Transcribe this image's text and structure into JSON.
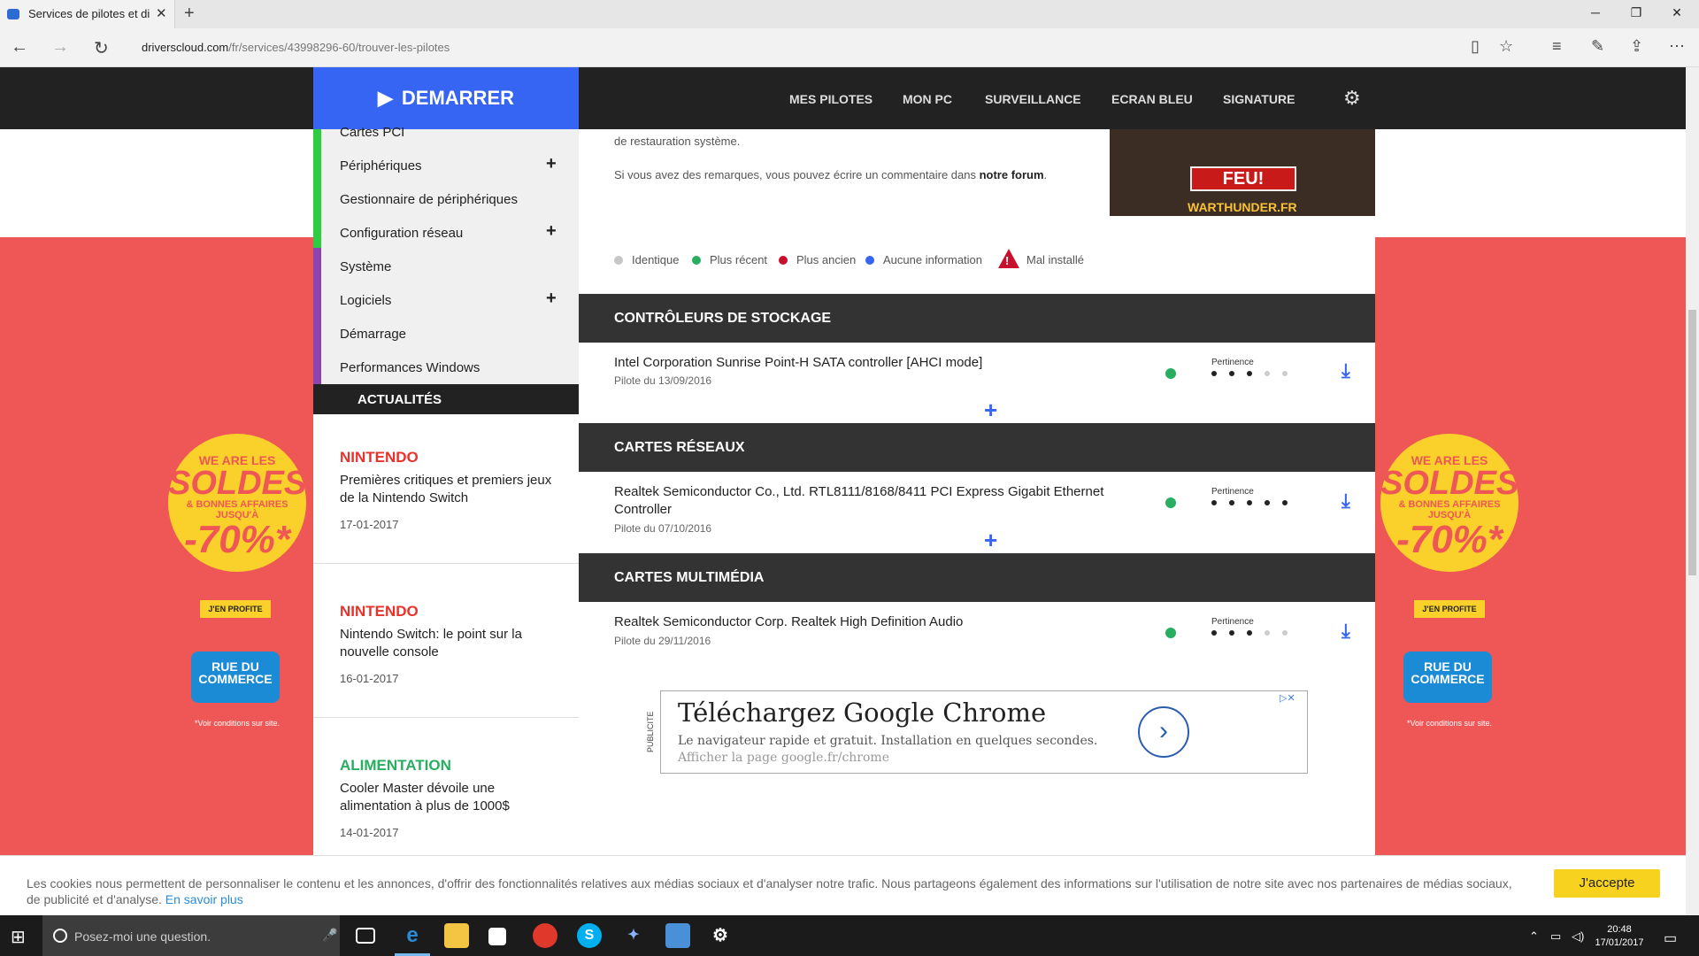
{
  "browser": {
    "tab_title": "Services de pilotes et di",
    "tab_close": "✕",
    "new_tab": "+",
    "url_domain": "driverscloud.com",
    "url_path": "/fr/services/43998296-60/trouver-les-pilotes"
  },
  "site_nav": {
    "demarrer": "DEMARRER",
    "links": [
      "MES PILOTES",
      "MON PC",
      "SURVEILLANCE",
      "ECRAN BLEU",
      "SIGNATURE"
    ]
  },
  "sidebar": {
    "items": [
      "Cartes PCI",
      "Périphériques",
      "Gestionnaire de périphériques",
      "Configuration réseau",
      "Système",
      "Logiciels",
      "Démarrage",
      "Performances Windows"
    ],
    "colors": [
      "#2ecc40",
      "#2ecc40",
      "#2ecc40",
      "#2ecc40",
      "#8e44ad",
      "#8e44ad",
      "#8e44ad",
      "#8e44ad"
    ],
    "actualites": "ACTUALITÉS",
    "news": [
      {
        "category": "NINTENDO",
        "text": "Premières critiques et premiers jeux de la Nintendo Switch",
        "date": "17-01-2017",
        "color": "#e8322b"
      },
      {
        "category": "NINTENDO",
        "text": "Nintendo Switch: le point sur la nouvelle console",
        "date": "16-01-2017",
        "color": "#e8322b"
      },
      {
        "category": "ALIMENTATION",
        "text": "Cooler Master dévoile une alimentation à plus de 1000$",
        "date": "14-01-2017",
        "color": "#27ae60"
      }
    ]
  },
  "main": {
    "para1": "de restauration système.",
    "para2_prefix": "Si vous avez des remarques, vous pouvez écrire un commentaire dans ",
    "para2_link": "notre forum",
    "para2_suffix": ".",
    "ad_image": {
      "button": "FEU!",
      "brand": "WARTHUNDER.FR"
    },
    "legend": [
      {
        "label": "Identique",
        "color": "#c7c7c7"
      },
      {
        "label": "Plus récent",
        "color": "#27ae60"
      },
      {
        "label": "Plus ancien",
        "color": "#c8102e"
      },
      {
        "label": "Aucune information",
        "color": "#3565f2"
      }
    ],
    "legend_warning": "Mal installé",
    "pertinence_label": "Pertinence",
    "sections": [
      {
        "title": "CONTRÔLEURS DE STOCKAGE",
        "device": "Intel Corporation Sunrise Point-H SATA controller [AHCI mode]",
        "date": "Pilote du 13/09/2016",
        "pertinence": 3
      },
      {
        "title": "CARTES RÉSEAUX",
        "device": "Realtek Semiconductor Co., Ltd. RTL8111/8168/8411 PCI Express Gigabit Ethernet Controller",
        "date": "Pilote du 07/10/2016",
        "pertinence": 5
      },
      {
        "title": "CARTES MULTIMÉDIA",
        "device": "Realtek Semiconductor Corp. Realtek High Definition Audio",
        "date": "Pilote du 29/11/2016",
        "pertinence": 3
      }
    ],
    "google_ad": {
      "label": "PUBLICITE",
      "title": "Téléchargez Google Chrome",
      "desc": "Le navigateur rapide et gratuit. Installation en quelques secondes.",
      "link": "Afficher la page google.fr/chrome"
    }
  },
  "promo": {
    "we_are": "WE ARE LES",
    "soldes": "SOLDES",
    "bonnes": "& BONNES AFFAIRES",
    "jusqua": "JUSQU'À",
    "pct": "-70%*",
    "cta": "J'EN PROFITE",
    "rdc": "RUE DU COMMERCE",
    "cond": "*Voir conditions sur site."
  },
  "cookie": {
    "text": "Les cookies nous permettent de personnaliser le contenu et les annonces, d'offrir des fonctionnalités relatives aux médias sociaux et d'analyser notre trafic. Nous partageons également des informations sur l'utilisation de notre site avec nos partenaires de médias sociaux, de publicité et d'analyse. ",
    "link": "En savoir plus",
    "button": "J'accepte"
  },
  "taskbar": {
    "search_placeholder": "Posez-moi une question.",
    "time": "20:48",
    "date": "17/01/2017"
  }
}
